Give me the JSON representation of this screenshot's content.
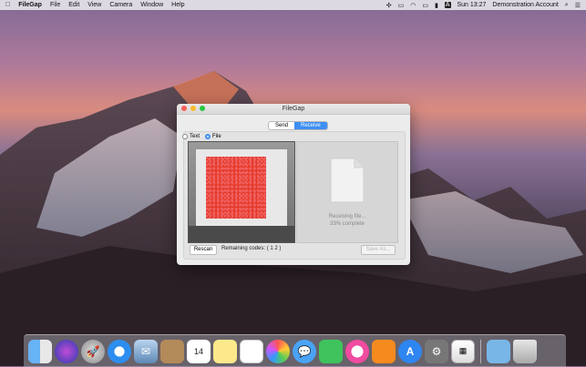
{
  "menubar": {
    "app_name": "FileGap",
    "items": [
      "File",
      "Edit",
      "View",
      "Camera",
      "Window",
      "Help"
    ],
    "status": {
      "clock": "Sun 13:27",
      "user": "Demonstration Account",
      "keyboard_letter": "A"
    }
  },
  "window": {
    "title": "FileGap",
    "segments": [
      "Send",
      "Receive"
    ],
    "active_segment": "Receive",
    "radio_text": "Text",
    "radio_file": "File",
    "selected_radio": "File",
    "receiving_line1": "Receiving file...",
    "receiving_line2": "33% complete",
    "rescan_label": "Rescan",
    "remaining_label": "Remaining  codes: ( 1 2 )",
    "save_as_label": "Save As..."
  },
  "dock": {
    "icons": [
      "finder-icon",
      "siri-icon",
      "launchpad-icon",
      "safari-icon",
      "mail-icon",
      "contacts-icon",
      "calendar-icon",
      "notes-icon",
      "reminders-icon",
      "photos-icon",
      "messages-icon",
      "facetime-icon",
      "itunes-icon",
      "ibooks-icon",
      "app-store-icon",
      "system-preferences-icon",
      "filegap-icon",
      "downloads-folder-icon",
      "trash-icon"
    ],
    "calendar_day": "14"
  },
  "colors": {
    "accent": "#3d8ff3",
    "qr_red": "#e43a2a"
  }
}
